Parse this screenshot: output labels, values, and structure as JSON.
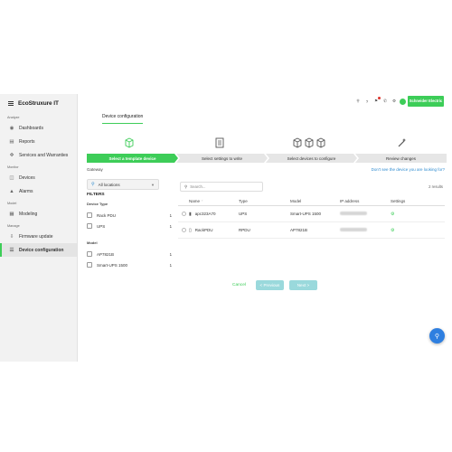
{
  "brand": {
    "name": "EcoStruxure IT"
  },
  "sidebar": {
    "sections": [
      {
        "title": "Analyze",
        "items": [
          {
            "label": "Dashboards",
            "icon": "eye-icon"
          },
          {
            "label": "Reports",
            "icon": "document-icon"
          },
          {
            "label": "Services and Warranties",
            "icon": "handshake-icon"
          }
        ]
      },
      {
        "title": "Monitor",
        "items": [
          {
            "label": "Devices",
            "icon": "devices-icon"
          },
          {
            "label": "Alarms",
            "icon": "bell-icon"
          }
        ]
      },
      {
        "title": "Model",
        "items": [
          {
            "label": "Modeling",
            "icon": "grid-icon"
          }
        ]
      },
      {
        "title": "Manage",
        "items": [
          {
            "label": "Firmware update",
            "icon": "download-icon"
          },
          {
            "label": "Device configuration",
            "icon": "sliders-icon",
            "active": true
          }
        ]
      }
    ]
  },
  "header": {
    "logo_text": "Schneider Electric"
  },
  "page": {
    "tab": "Device configuration"
  },
  "steps": [
    {
      "label": "Select a template device",
      "icon": "cube-icon",
      "active": true
    },
    {
      "label": "Select settings to write",
      "icon": "document-icon"
    },
    {
      "label": "Select devices to configure",
      "icon": "cubes-icon"
    },
    {
      "label": "Review changes",
      "icon": "magic-wand-icon"
    }
  ],
  "gateway": {
    "label": "Gateway",
    "link": "Don't see the device you are looking for?"
  },
  "location": {
    "value": "All locations"
  },
  "filters": {
    "title": "FILTERS",
    "groups": [
      {
        "title": "Device Type",
        "options": [
          {
            "label": "Rack PDU",
            "count": "1"
          },
          {
            "label": "UPS",
            "count": "1"
          }
        ]
      },
      {
        "title": "Model",
        "options": [
          {
            "label": "AP7821B",
            "count": "1"
          },
          {
            "label": "Smart-UPS 1500",
            "count": "1"
          }
        ]
      }
    ]
  },
  "search": {
    "placeholder": "Search..."
  },
  "results": {
    "count": "2 results"
  },
  "table": {
    "headers": {
      "name": "Name",
      "type": "Type",
      "model": "Model",
      "ip": "IP address",
      "settings": "Settings"
    },
    "rows": [
      {
        "name": "apc323A70",
        "type": "UPS",
        "model": "Smart-UPS 1500",
        "icon": "ups-icon"
      },
      {
        "name": "RackPDU",
        "type": "RPDU",
        "model": "AP7821B",
        "icon": "pdu-icon"
      }
    ]
  },
  "footer": {
    "cancel": "Cancel",
    "previous": "< Previous",
    "next": "Next >"
  },
  "colors": {
    "accent": "#3dcd58",
    "link": "#2e8bd0",
    "disabled_button": "#9ad9dc",
    "fab": "#2e7fe0"
  }
}
